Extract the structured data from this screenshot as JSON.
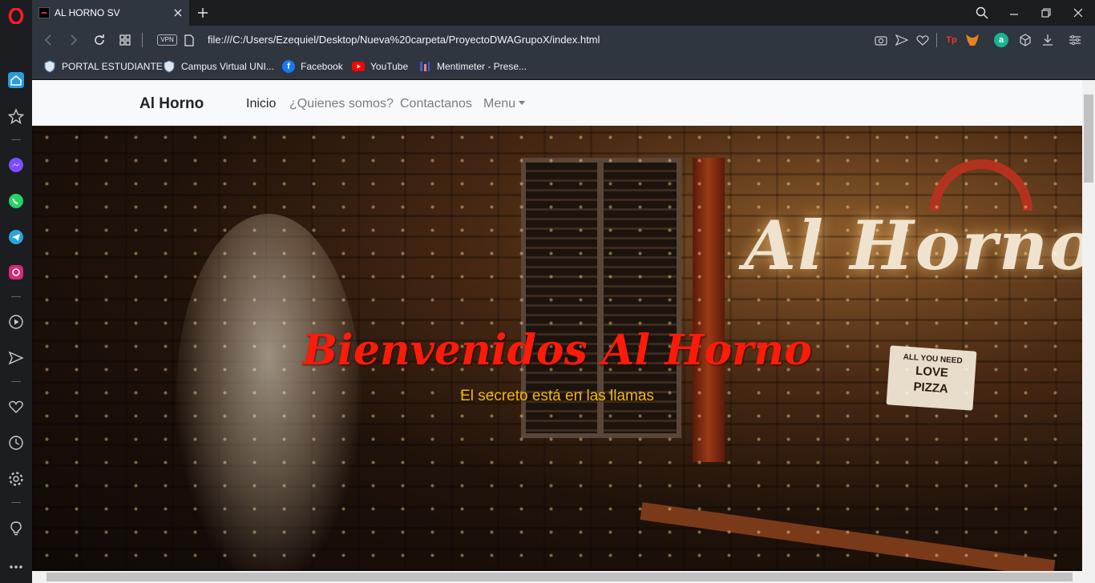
{
  "tab": {
    "title": "AL HORNO SV"
  },
  "address": {
    "url": "file:///C:/Users/Ezequiel/Desktop/Nueva%20carpeta/ProyectoDWAGrupoX/index.html",
    "vpn_label": "VPN"
  },
  "extensions": {
    "tp_label": "Tp",
    "a_label": "a"
  },
  "bookmarks": [
    {
      "label": "PORTAL ESTUDIANTE",
      "icon": "shield-icon"
    },
    {
      "label": "Campus Virtual UNI...",
      "icon": "shield-icon"
    },
    {
      "label": "Facebook",
      "icon": "facebook-icon"
    },
    {
      "label": "YouTube",
      "icon": "youtube-icon"
    },
    {
      "label": "Mentimeter - Prese...",
      "icon": "mentimeter-icon"
    }
  ],
  "site": {
    "brand": "Al Horno",
    "nav": [
      "Inicio",
      "¿Quienes somos?",
      "Contactanos",
      "Menu"
    ],
    "hero_title": "Bienvenidos Al Horno",
    "hero_subtitle": "El secreto está en las llamas",
    "sign_text": "Al Horno",
    "board_text": [
      "ALL YOU NEED",
      "LOVE",
      "PIZZA"
    ]
  },
  "colors": {
    "hero_title": "#ff1a0a",
    "hero_subtitle": "#f5b800",
    "opera_red": "#ff1b2d"
  }
}
